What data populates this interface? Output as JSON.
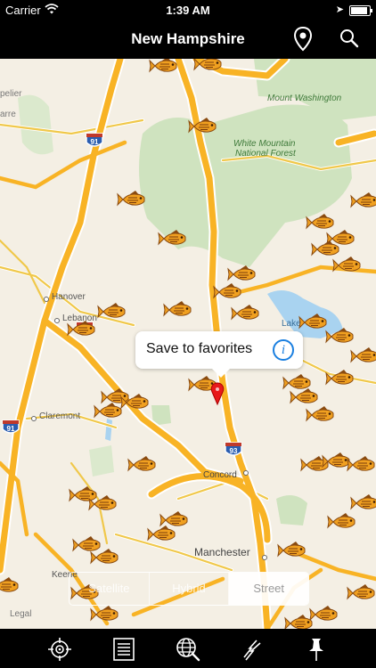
{
  "status": {
    "carrier": "Carrier",
    "time": "1:39 AM",
    "battery_level": 0.92
  },
  "nav": {
    "title": "New Hampshire"
  },
  "map": {
    "places": {
      "mount_washington": "Mount Washington",
      "forest_line1": "White Mountain",
      "forest_line2": "National Forest",
      "hanover": "Hanover",
      "lebanon": "Lebanon",
      "claremont": "Claremont",
      "concord": "Concord",
      "manchester": "Manchester",
      "keene": "Keene",
      "lake": "Lake",
      "barre": "arre",
      "montpelier": "pelier"
    },
    "shields": {
      "i91_north": "91",
      "i89": "89",
      "i91_south": "91",
      "i93": "93"
    },
    "legal": "Legal",
    "callout": {
      "text": "Save to favorites"
    },
    "map_type": {
      "satellite": "Satellite",
      "hybrid": "Hybrid",
      "street": "Street"
    }
  },
  "toolbar": [
    "locate-icon",
    "list-icon",
    "globe-icon",
    "weather-icon",
    "pushpin-icon"
  ]
}
